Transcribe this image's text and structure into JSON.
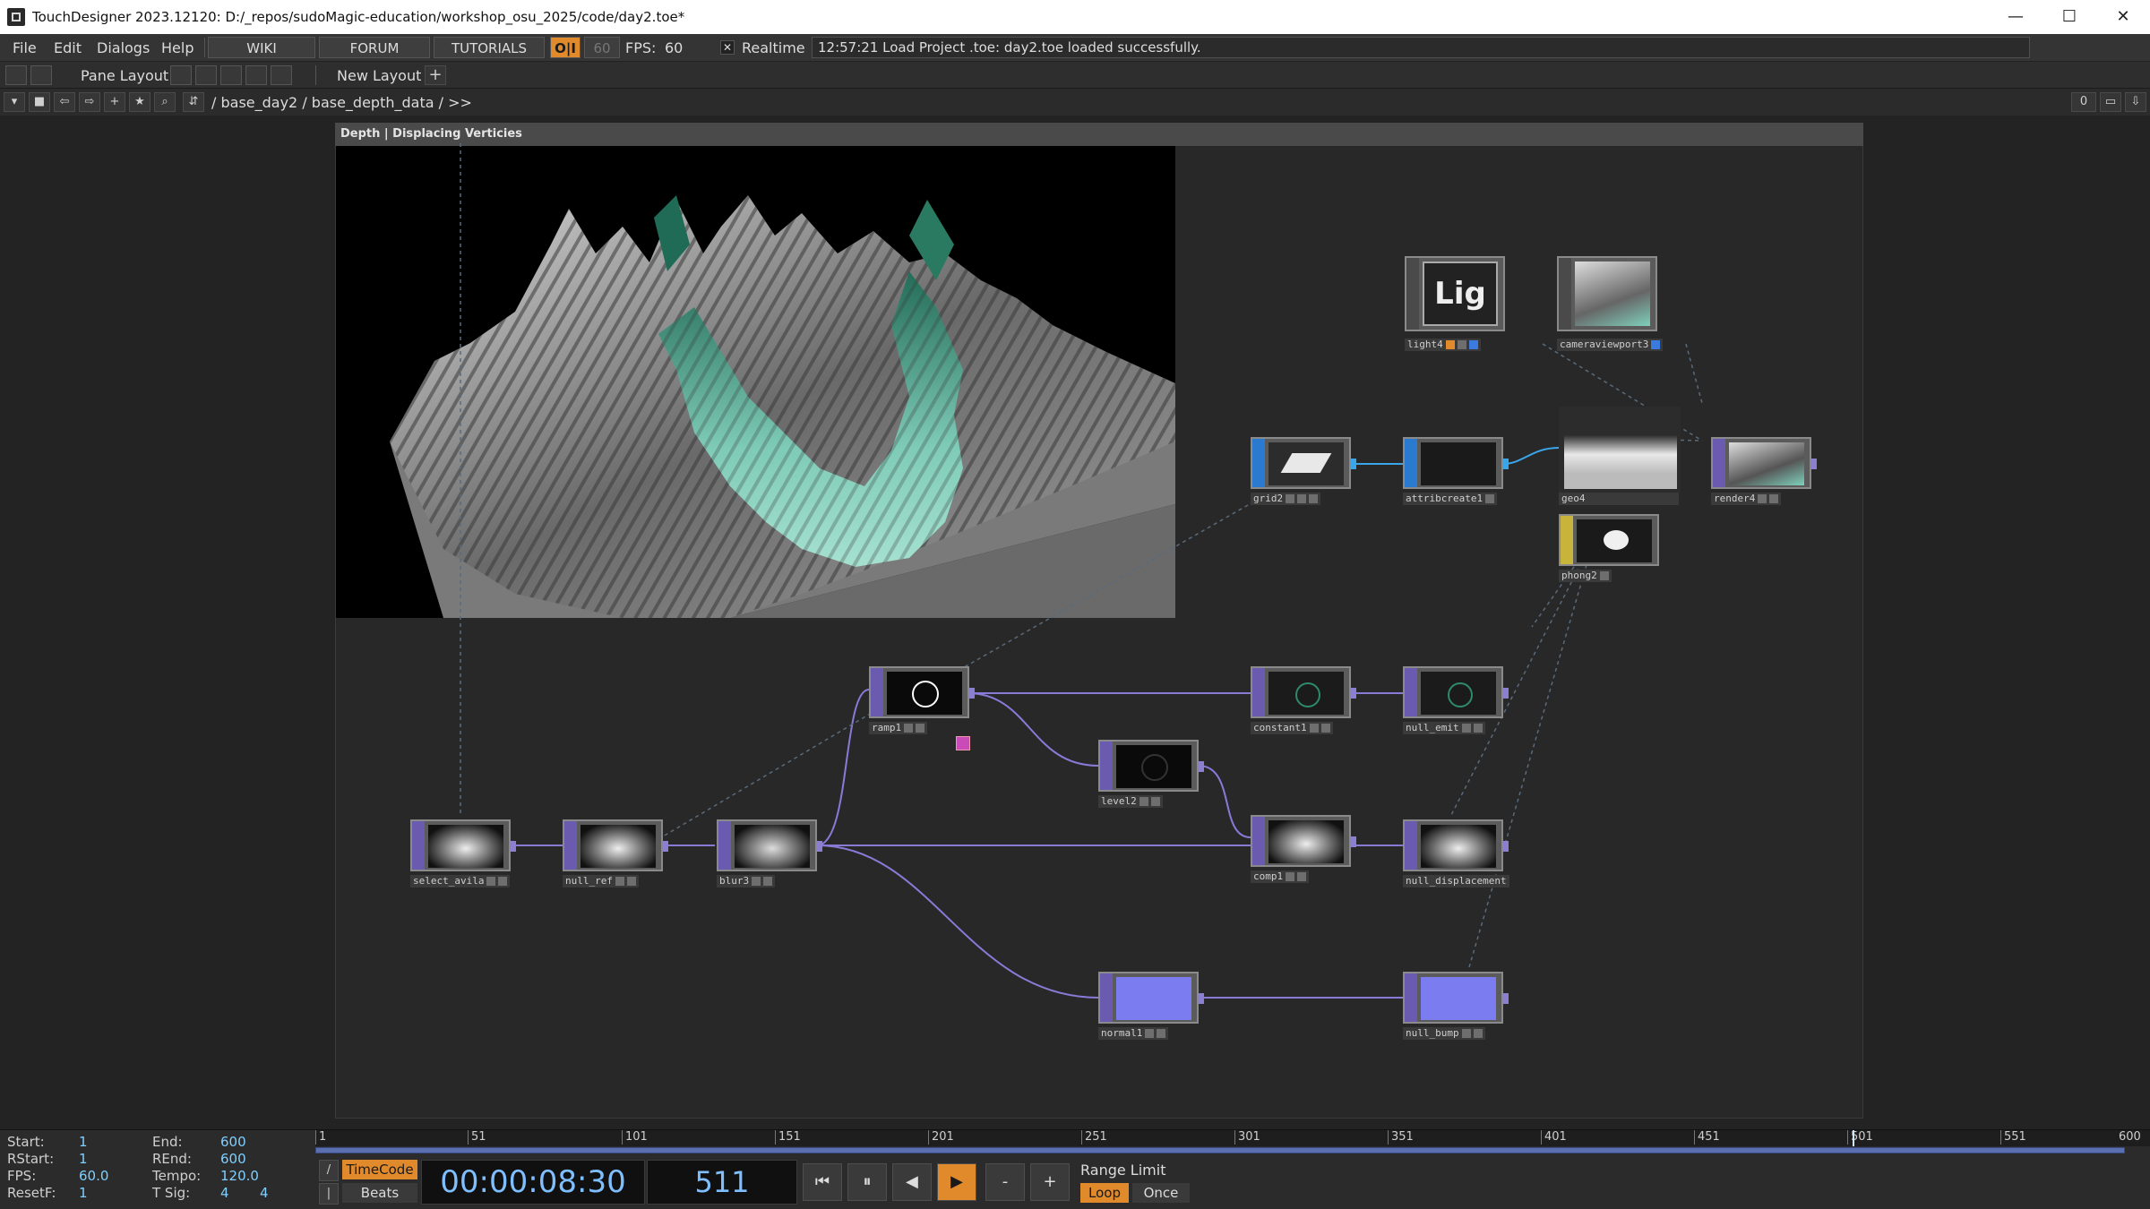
{
  "window": {
    "title": "TouchDesigner 2023.12120: D:/_repos/sudoMagic-education/workshop_osu_2025/code/day2.toe*",
    "minimize": "—",
    "maximize": "☐",
    "close": "✕"
  },
  "menu": {
    "items": [
      "File",
      "Edit",
      "Dialogs",
      "Help"
    ],
    "wiki": "WIKI",
    "forum": "FORUM",
    "tutorials": "TUTORIALS",
    "oi": "O|I",
    "fps_cap": "60",
    "fps_label": "FPS:",
    "fps_value": "60",
    "realtime_check": "✕",
    "realtime": "Realtime",
    "status": "12:57:21 Load Project .toe: day2.toe loaded successfully."
  },
  "layoutbar": {
    "pane_layout": "Pane Layout",
    "new_layout": "New Layout",
    "add": "+"
  },
  "pathbar": {
    "path": "/ base_day2 / base_depth_data / >>",
    "counter": "0"
  },
  "network": {
    "container_title": "Depth | Displacing Verticies",
    "light_text": "Lig",
    "nodes": {
      "light4": "light4",
      "cameraviewport3": "cameraviewport3",
      "grid2": "grid2",
      "attribcreate1": "attribcreate1",
      "geo4": "geo4",
      "render4": "render4",
      "phong2": "phong2",
      "ramp1": "ramp1",
      "constant1": "constant1",
      "null_emit": "null_emit",
      "level2": "level2",
      "select_avila": "select_avila",
      "null_ref": "null_ref",
      "blur3": "blur3",
      "comp1": "comp1",
      "null_displacement": "null_displacement",
      "normal1": "normal1",
      "null_bump": "null_bump"
    }
  },
  "stats": {
    "start_label": "Start:",
    "start": "1",
    "end_label": "End:",
    "end": "600",
    "rstart_label": "RStart:",
    "rstart": "1",
    "rend_label": "REnd:",
    "rend": "600",
    "fps_label": "FPS:",
    "fps": "60.0",
    "tempo_label": "Tempo:",
    "tempo": "120.0",
    "resetf_label": "ResetF:",
    "resetf": "1",
    "tsig_label": "T Sig:",
    "tsig_a": "4",
    "tsig_b": "4"
  },
  "timeline": {
    "ticks": [
      "1",
      "51",
      "101",
      "151",
      "201",
      "251",
      "301",
      "351",
      "401",
      "451",
      "501",
      "551",
      "600"
    ],
    "current_frame": 511
  },
  "transport": {
    "timecode": "TimeCode",
    "beats": "Beats",
    "time": "00:00:08:30",
    "frame": "511",
    "btn_start": "⏮",
    "btn_pause": "⏸",
    "btn_back": "◀",
    "btn_play": "▶",
    "btn_minus": "-",
    "btn_plus": "+",
    "range_limit": "Range Limit",
    "loop": "Loop",
    "once": "Once"
  },
  "colors": {
    "accent_orange": "#e08a2c",
    "top_operator": "#6b5bb0",
    "sop_operator": "#2a7bd0",
    "mat_operator": "#c8b43a",
    "wire": "#8a7ad8",
    "time_blue": "#7fbfff"
  }
}
